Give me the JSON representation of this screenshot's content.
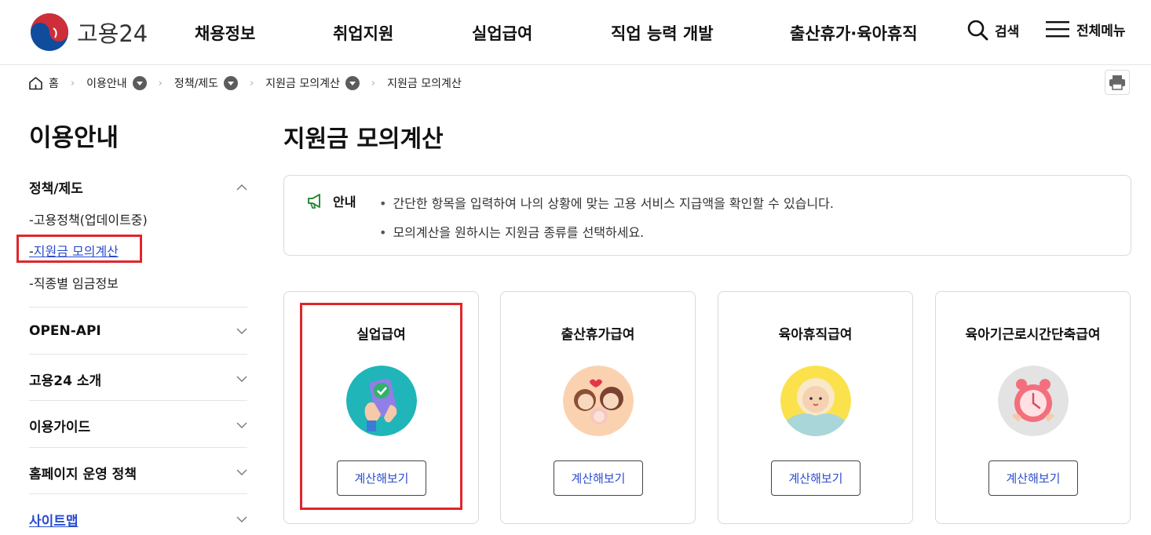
{
  "header": {
    "logo_text": "고용24",
    "nav": [
      "채용정보",
      "취업지원",
      "실업급여",
      "직업 능력 개발",
      "출산휴가·육아휴직"
    ],
    "search_label": "검색",
    "menu_label": "전체메뉴"
  },
  "breadcrumb": {
    "home": "홈",
    "items": [
      "이용안내",
      "정책/제도",
      "지원금 모의계산",
      "지원금 모의계산"
    ]
  },
  "sidebar": {
    "title": "이용안내",
    "groups": [
      {
        "label": "정책/제도",
        "expanded": true,
        "items": [
          "고용정책(업데이트중)",
          "지원금 모의계산",
          "직종별 임금정보"
        ],
        "active_index": 1
      },
      {
        "label": "OPEN-API"
      },
      {
        "label": "고용24 소개"
      },
      {
        "label": "이용가이드"
      },
      {
        "label": "홈페이지 운영 정책"
      },
      {
        "label": "사이트맵"
      }
    ]
  },
  "main": {
    "title": "지원금 모의계산",
    "notice": {
      "label": "안내",
      "lines": [
        "간단한 항목을 입력하여 나의 상황에 맞는 고용 서비스 지급액을 확인할 수 있습니다.",
        "모의계산을 원하시는 지원금 종류를 선택하세요."
      ]
    },
    "cards": [
      {
        "title": "실업급여",
        "button": "계산해보기",
        "icon": "phone-check-icon"
      },
      {
        "title": "출산휴가급여",
        "button": "계산해보기",
        "icon": "parents-baby-icon"
      },
      {
        "title": "육아휴직급여",
        "button": "계산해보기",
        "icon": "baby-icon"
      },
      {
        "title": "육아기근로시간단축급여",
        "button": "계산해보기",
        "icon": "alarm-clock-icon"
      }
    ]
  },
  "colors": {
    "accent_blue": "#2a4ccf",
    "highlight_red": "#e0262b",
    "logo_red": "#cd2e3a",
    "logo_blue": "#0f4c9c"
  }
}
